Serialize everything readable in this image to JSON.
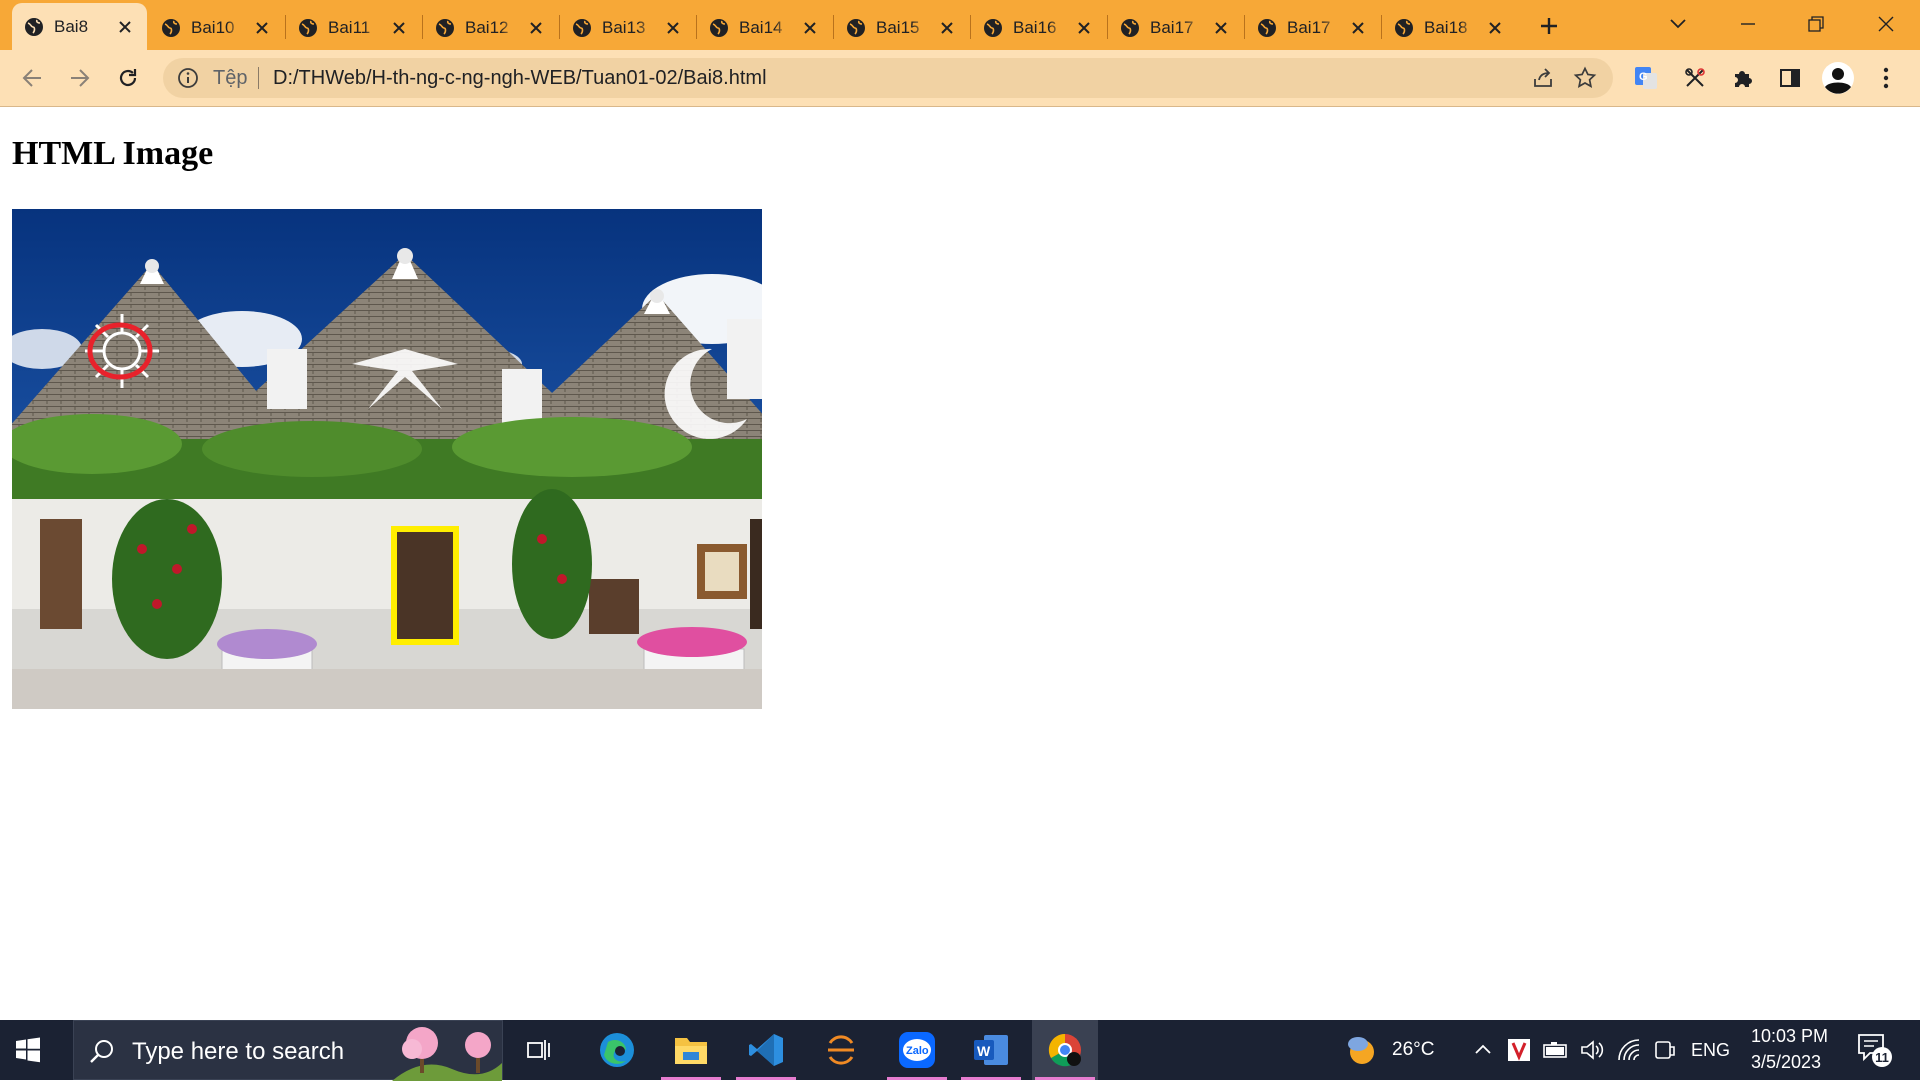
{
  "browser": {
    "tabs": [
      {
        "title": "Bai8",
        "active": true
      },
      {
        "title": "Bai10",
        "active": false
      },
      {
        "title": "Bai11",
        "active": false
      },
      {
        "title": "Bai12",
        "active": false
      },
      {
        "title": "Bai13",
        "active": false
      },
      {
        "title": "Bai14",
        "active": false
      },
      {
        "title": "Bai15",
        "active": false
      },
      {
        "title": "Bai16",
        "active": false
      },
      {
        "title": "Bai17",
        "active": false
      },
      {
        "title": "Bai17",
        "active": false
      },
      {
        "title": "Bai18",
        "active": false
      }
    ],
    "address": {
      "protocol_label": "Tệp",
      "url": "D:/THWeb/H-th-ng-c-ng-ngh-WEB/Tuan01-02/Bai8.html"
    }
  },
  "page": {
    "heading": "HTML Image"
  },
  "taskbar": {
    "search_placeholder": "Type here to search",
    "weather": "26°C",
    "language": "ENG",
    "time": "10:03 PM",
    "date": "3/5/2023",
    "notification_count": "11"
  },
  "colors": {
    "tabstrip": "#f7a837",
    "toolbar": "#fde0b5",
    "taskbar": "#1b2233",
    "image_map_circle": "#e8222b",
    "image_map_rect": "#ffee00"
  },
  "icons": [
    "globe-icon",
    "close-icon",
    "plus-icon",
    "chevron-down-icon",
    "minimize-icon",
    "restore-icon",
    "back-icon",
    "forward-icon",
    "reload-icon",
    "info-icon",
    "share-icon",
    "star-icon",
    "translate-icon",
    "extension-icon",
    "puzzle-icon",
    "side-panel-icon",
    "profile-avatar",
    "menu-icon",
    "windows-start-icon",
    "search-icon",
    "task-view-icon",
    "edge-icon",
    "file-explorer-icon",
    "vscode-icon",
    "sublime-icon",
    "zalo-icon",
    "word-icon",
    "chrome-icon",
    "weather-icon",
    "chevron-up-icon",
    "antivirus-icon",
    "battery-icon",
    "volume-icon",
    "wifi-icon",
    "notification-icon"
  ]
}
